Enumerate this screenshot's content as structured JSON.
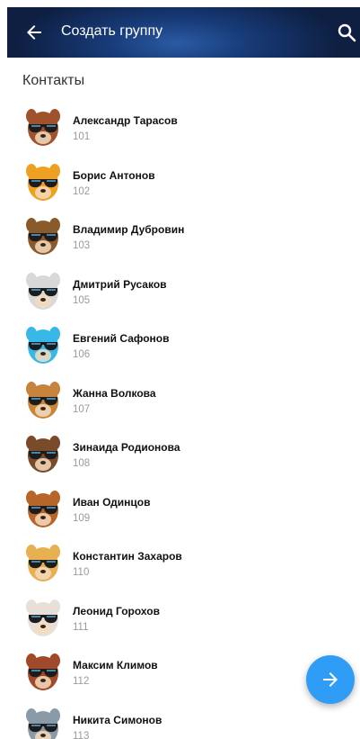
{
  "header": {
    "title": "Создать группу",
    "back_icon": "arrow-left-icon",
    "search_icon": "search-icon"
  },
  "section_title": "Контакты",
  "contacts": [
    {
      "name": "Александр Тарасов",
      "ext": "101",
      "avatar": "monkey",
      "color": "#a0522d"
    },
    {
      "name": "Борис Антонов",
      "ext": "102",
      "avatar": "cat",
      "color": "#f0a020"
    },
    {
      "name": "Владимир Дубровин",
      "ext": "103",
      "avatar": "hedgehog",
      "color": "#8b5a2b"
    },
    {
      "name": "Дмитрий Русаков",
      "ext": "105",
      "avatar": "cow",
      "color": "#d8d8d8"
    },
    {
      "name": "Евгений Сафонов",
      "ext": "106",
      "avatar": "alien",
      "color": "#38b8e8"
    },
    {
      "name": "Жанна Волкова",
      "ext": "107",
      "avatar": "kangaroo",
      "color": "#c8843c"
    },
    {
      "name": "Зинаида Родионова",
      "ext": "108",
      "avatar": "bison",
      "color": "#7a4b2a"
    },
    {
      "name": "Иван Одинцов",
      "ext": "109",
      "avatar": "lion",
      "color": "#b8652a"
    },
    {
      "name": "Константин Захаров",
      "ext": "110",
      "avatar": "meerkat",
      "color": "#e8b050"
    },
    {
      "name": "Леонид Горохов",
      "ext": "111",
      "avatar": "fox",
      "color": "#e8e0d8"
    },
    {
      "name": "Максим Климов",
      "ext": "112",
      "avatar": "gorilla",
      "color": "#a04a2a"
    },
    {
      "name": "Никита Симонов",
      "ext": "113",
      "avatar": "elephant",
      "color": "#8a9aa8"
    }
  ],
  "fab": {
    "icon": "arrow-right-icon",
    "color": "#2f9df5"
  }
}
